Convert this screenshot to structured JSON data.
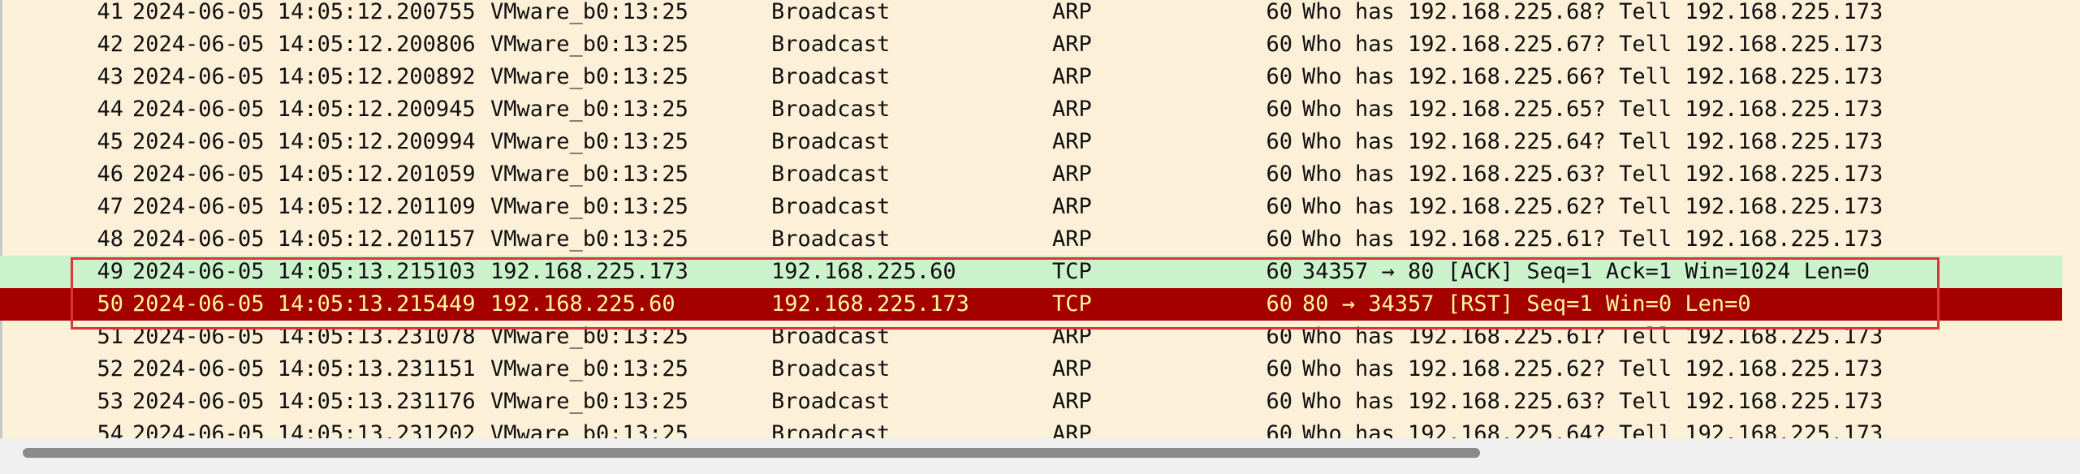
{
  "packets": [
    {
      "no": "41",
      "time": "2024-06-05 14:05:12.200755",
      "source": "VMware_b0:13:25",
      "destination": "Broadcast",
      "protocol": "ARP",
      "length": "60",
      "info": "Who has 192.168.225.68? Tell 192.168.225.173",
      "style": "normal"
    },
    {
      "no": "42",
      "time": "2024-06-05 14:05:12.200806",
      "source": "VMware_b0:13:25",
      "destination": "Broadcast",
      "protocol": "ARP",
      "length": "60",
      "info": "Who has 192.168.225.67? Tell 192.168.225.173",
      "style": "normal"
    },
    {
      "no": "43",
      "time": "2024-06-05 14:05:12.200892",
      "source": "VMware_b0:13:25",
      "destination": "Broadcast",
      "protocol": "ARP",
      "length": "60",
      "info": "Who has 192.168.225.66? Tell 192.168.225.173",
      "style": "normal"
    },
    {
      "no": "44",
      "time": "2024-06-05 14:05:12.200945",
      "source": "VMware_b0:13:25",
      "destination": "Broadcast",
      "protocol": "ARP",
      "length": "60",
      "info": "Who has 192.168.225.65? Tell 192.168.225.173",
      "style": "normal"
    },
    {
      "no": "45",
      "time": "2024-06-05 14:05:12.200994",
      "source": "VMware_b0:13:25",
      "destination": "Broadcast",
      "protocol": "ARP",
      "length": "60",
      "info": "Who has 192.168.225.64? Tell 192.168.225.173",
      "style": "normal"
    },
    {
      "no": "46",
      "time": "2024-06-05 14:05:12.201059",
      "source": "VMware_b0:13:25",
      "destination": "Broadcast",
      "protocol": "ARP",
      "length": "60",
      "info": "Who has 192.168.225.63? Tell 192.168.225.173",
      "style": "normal"
    },
    {
      "no": "47",
      "time": "2024-06-05 14:05:12.201109",
      "source": "VMware_b0:13:25",
      "destination": "Broadcast",
      "protocol": "ARP",
      "length": "60",
      "info": "Who has 192.168.225.62? Tell 192.168.225.173",
      "style": "normal"
    },
    {
      "no": "48",
      "time": "2024-06-05 14:05:12.201157",
      "source": "VMware_b0:13:25",
      "destination": "Broadcast",
      "protocol": "ARP",
      "length": "60",
      "info": "Who has 192.168.225.61? Tell 192.168.225.173",
      "style": "normal"
    },
    {
      "no": "49",
      "time": "2024-06-05 14:05:13.215103",
      "source": "192.168.225.173",
      "destination": "192.168.225.60",
      "protocol": "TCP",
      "length": "60",
      "info": "34357 → 80 [ACK] Seq=1 Ack=1 Win=1024 Len=0",
      "style": "tcp-ack"
    },
    {
      "no": "50",
      "time": "2024-06-05 14:05:13.215449",
      "source": "192.168.225.60",
      "destination": "192.168.225.173",
      "protocol": "TCP",
      "length": "60",
      "info": "80 → 34357 [RST] Seq=1 Win=0 Len=0",
      "style": "tcp-rst"
    },
    {
      "no": "51",
      "time": "2024-06-05 14:05:13.231078",
      "source": "VMware_b0:13:25",
      "destination": "Broadcast",
      "protocol": "ARP",
      "length": "60",
      "info": "Who has 192.168.225.61? Tell 192.168.225.173",
      "style": "normal"
    },
    {
      "no": "52",
      "time": "2024-06-05 14:05:13.231151",
      "source": "VMware_b0:13:25",
      "destination": "Broadcast",
      "protocol": "ARP",
      "length": "60",
      "info": "Who has 192.168.225.62? Tell 192.168.225.173",
      "style": "normal"
    },
    {
      "no": "53",
      "time": "2024-06-05 14:05:13.231176",
      "source": "VMware_b0:13:25",
      "destination": "Broadcast",
      "protocol": "ARP",
      "length": "60",
      "info": "Who has 192.168.225.63? Tell 192.168.225.173",
      "style": "normal"
    },
    {
      "no": "54",
      "time": "2024-06-05 14:05:13.231202",
      "source": "VMware_b0:13:25",
      "destination": "Broadcast",
      "protocol": "ARP",
      "length": "60",
      "info": "Who has 192.168.225.64? Tell 192.168.225.173",
      "style": "normal"
    }
  ],
  "colors": {
    "row_background": "#fdf0d8",
    "tcp_ack_background": "#ccf2cc",
    "tcp_rst_background": "#a40000",
    "tcp_rst_text": "#fff5a0",
    "annotation_box": "#e0343b"
  }
}
